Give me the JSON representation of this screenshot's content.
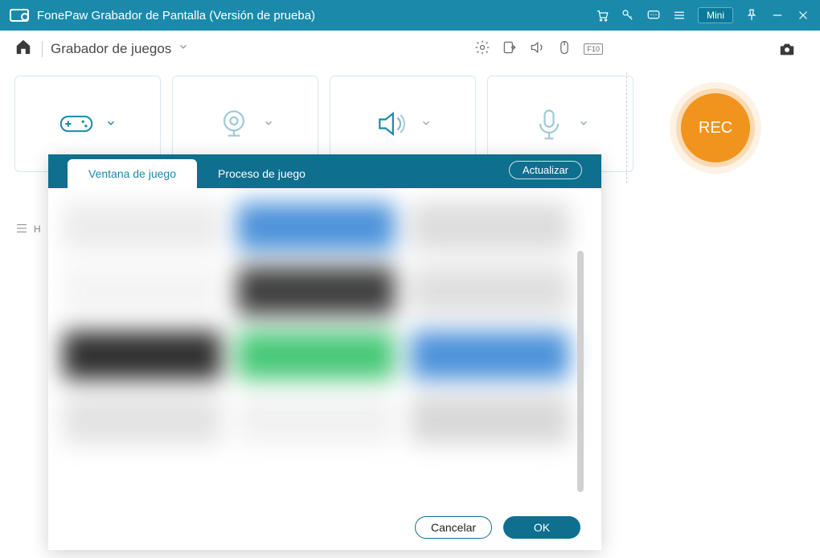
{
  "titlebar": {
    "title": "FonePaw Grabador de Pantalla (Versión de prueba)",
    "mini_label": "Mini"
  },
  "modebar": {
    "mode_label": "Grabador de juegos",
    "f10_label": "F10"
  },
  "rec": {
    "label": "REC"
  },
  "bottom": {
    "letter": "H"
  },
  "modal": {
    "tabs": [
      {
        "label": "Ventana de juego"
      },
      {
        "label": "Proceso de juego"
      }
    ],
    "refresh_label": "Actualizar",
    "cancel_label": "Cancelar",
    "ok_label": "OK"
  }
}
